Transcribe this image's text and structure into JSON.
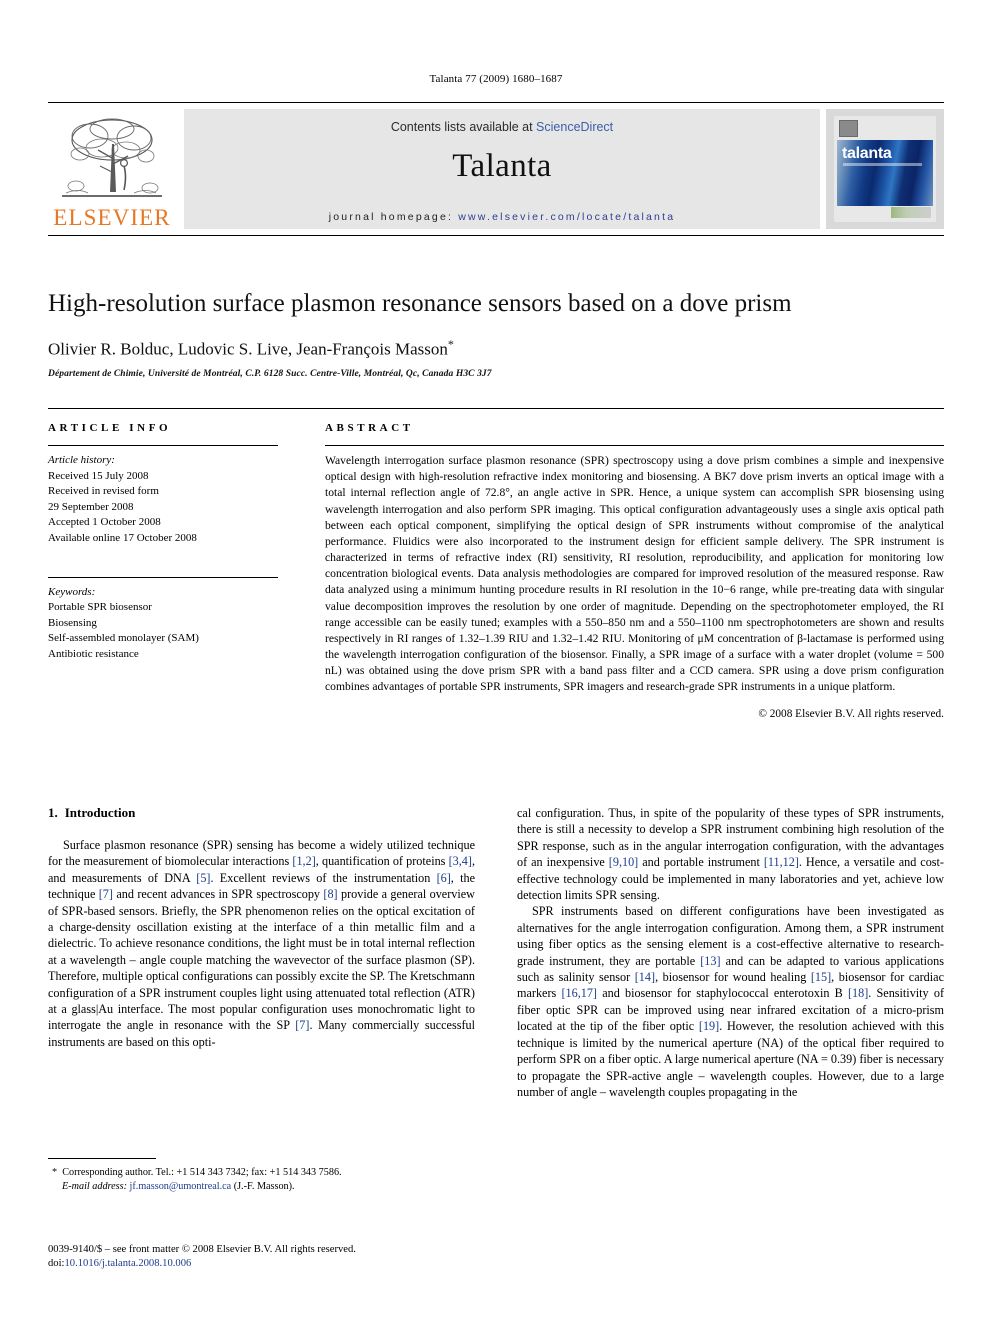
{
  "running_head": "Talanta 77 (2009) 1680–1687",
  "masthead": {
    "publisher_wordmark": "ELSEVIER",
    "contents_prefix": "Contents lists available at ",
    "contents_link": "ScienceDirect",
    "journal_title": "Talanta",
    "homepage_prefix": "journal homepage: ",
    "homepage_url": "www.elsevier.com/locate/talanta",
    "cover_title": "talanta"
  },
  "article": {
    "title": "High-resolution surface plasmon resonance sensors based on a dove prism",
    "authors": "Olivier R. Bolduc, Ludovic S. Live, Jean-François Masson",
    "author_star": "*",
    "affiliation": "Département de Chimie, Université de Montréal, C.P. 6128 Succ. Centre-Ville, Montréal, Qc, Canada H3C 3J7"
  },
  "info": {
    "label": "ARTICLE INFO",
    "history_label": "Article history:",
    "history_lines": [
      "Received 15 July 2008",
      "Received in revised form",
      "29 September 2008",
      "Accepted 1 October 2008",
      "Available online 17 October 2008"
    ],
    "keywords_label": "Keywords:",
    "keywords": [
      "Portable SPR biosensor",
      "Biosensing",
      "Self-assembled monolayer (SAM)",
      "Antibiotic resistance"
    ]
  },
  "abstract": {
    "label": "ABSTRACT",
    "text": "Wavelength interrogation surface plasmon resonance (SPR) spectroscopy using a dove prism combines a simple and inexpensive optical design with high-resolution refractive index monitoring and biosensing. A BK7 dove prism inverts an optical image with a total internal reflection angle of 72.8°, an angle active in SPR. Hence, a unique system can accomplish SPR biosensing using wavelength interrogation and also perform SPR imaging. This optical configuration advantageously uses a single axis optical path between each optical component, simplifying the optical design of SPR instruments without compromise of the analytical performance. Fluidics were also incorporated to the instrument design for efficient sample delivery. The SPR instrument is characterized in terms of refractive index (RI) sensitivity, RI resolution, reproducibility, and application for monitoring low concentration biological events. Data analysis methodologies are compared for improved resolution of the measured response. Raw data analyzed using a minimum hunting procedure results in RI resolution in the 10−6 range, while pre-treating data with singular value decomposition improves the resolution by one order of magnitude. Depending on the spectrophotometer employed, the RI range accessible can be easily tuned; examples with a 550–850 nm and a 550–1100 nm spectrophotometers are shown and results respectively in RI ranges of 1.32–1.39 RIU and 1.32–1.42 RIU. Monitoring of μM concentration of β-lactamase is performed using the wavelength interrogation configuration of the biosensor. Finally, a SPR image of a surface with a water droplet (volume = 500 nL) was obtained using the dove prism SPR with a band pass filter and a CCD camera. SPR using a dove prism configuration combines advantages of portable SPR instruments, SPR imagers and research-grade SPR instruments in a unique platform.",
    "copyright": "© 2008 Elsevier B.V. All rights reserved."
  },
  "body": {
    "section_number": "1.",
    "section_title": "Introduction",
    "left_paragraph_1_a": "Surface plasmon resonance (SPR) sensing has become a widely utilized technique for the measurement of biomolecular interactions ",
    "ref_1_2": "[1,2]",
    "left_paragraph_1_b": ", quantification of proteins ",
    "ref_3_4": "[3,4]",
    "left_paragraph_1_c": ", and measurements of DNA ",
    "ref_5": "[5]",
    "left_paragraph_1_d": ". Excellent reviews of the instrumentation ",
    "ref_6": "[6]",
    "left_paragraph_1_e": ", the technique ",
    "ref_7": "[7]",
    "left_paragraph_1_f": " and recent advances in SPR spectroscopy ",
    "ref_8": "[8]",
    "left_paragraph_1_g": " provide a general overview of SPR-based sensors. Briefly, the SPR phenomenon relies on the optical excitation of a charge-density oscillation existing at the interface of a thin metallic film and a dielectric. To achieve resonance conditions, the light must be in total internal reflection at a wavelength – angle couple matching the wavevector of the surface plasmon (SP). Therefore, multiple optical configurations can possibly excite the SP. The Kretschmann configuration of a SPR instrument couples light using attenuated total reflection (ATR) at a glass|Au interface. The most popular configuration uses monochromatic light to interrogate the angle in resonance with the SP ",
    "ref_7b": "[7]",
    "left_paragraph_1_h": ". Many commercially successful instruments are based on this opti-",
    "right_paragraph_1_a": "cal configuration. Thus, in spite of the popularity of these types of SPR instruments, there is still a necessity to develop a SPR instrument combining high resolution of the SPR response, such as in the angular interrogation configuration, with the advantages of an inexpensive ",
    "ref_9_10": "[9,10]",
    "right_paragraph_1_b": " and portable instrument ",
    "ref_11_12": "[11,12]",
    "right_paragraph_1_c": ". Hence, a versatile and cost-effective technology could be implemented in many laboratories and yet, achieve low detection limits SPR sensing.",
    "right_paragraph_2_a": "SPR instruments based on different configurations have been investigated as alternatives for the angle interrogation configuration. Among them, a SPR instrument using fiber optics as the sensing element is a cost-effective alternative to research-grade instrument, they are portable ",
    "ref_13": "[13]",
    "right_paragraph_2_b": " and can be adapted to various applications such as salinity sensor ",
    "ref_14": "[14]",
    "right_paragraph_2_c": ", biosensor for wound healing ",
    "ref_15": "[15]",
    "right_paragraph_2_d": ", biosensor for cardiac markers ",
    "ref_16_17": "[16,17]",
    "right_paragraph_2_e": " and biosensor for staphylococcal enterotoxin B ",
    "ref_18": "[18]",
    "right_paragraph_2_f": ". Sensitivity of fiber optic SPR can be improved using near infrared excitation of a micro-prism located at the tip of the fiber optic ",
    "ref_19": "[19]",
    "right_paragraph_2_g": ". However, the resolution achieved with this technique is limited by the numerical aperture (NA) of the optical fiber required to perform SPR on a fiber optic. A large numerical aperture (NA = 0.39) fiber is necessary to propagate the SPR-active angle – wavelength couples. However, due to a large number of angle – wavelength couples propagating in the"
  },
  "footnote": {
    "marker": "*",
    "corresponding": "Corresponding author. Tel.: +1 514 343 7342; fax: +1 514 343 7586.",
    "email_label": "E-mail address:",
    "email": "jf.masson@umontreal.ca",
    "email_suffix": "(J.-F. Masson)."
  },
  "footer": {
    "issn_line": "0039-9140/$ – see front matter © 2008 Elsevier B.V. All rights reserved.",
    "doi_label": "doi:",
    "doi_value": "10.1016/j.talanta.2008.10.006"
  }
}
